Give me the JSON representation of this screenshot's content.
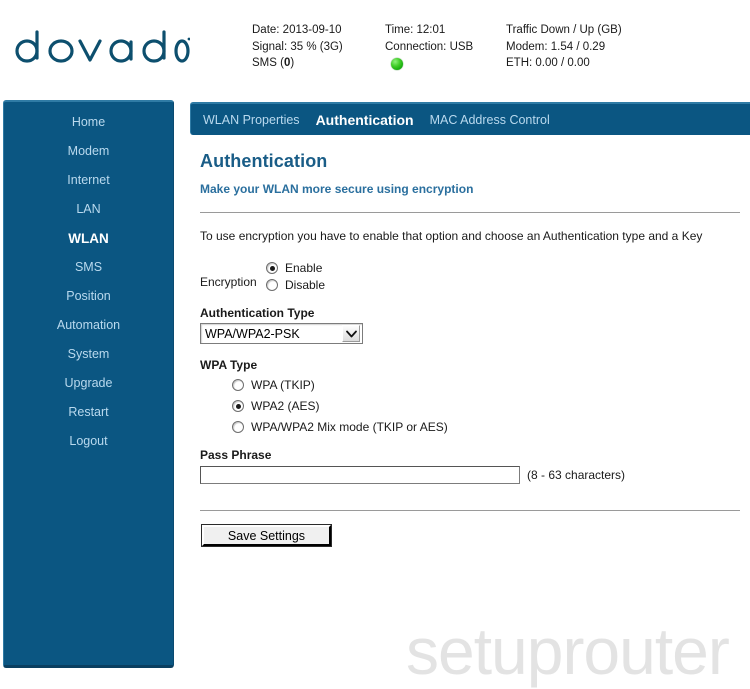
{
  "brand": {
    "logo_text": "dovado",
    "logo_color": "#0d4f6e"
  },
  "status_bar": {
    "col1": {
      "date": "Date: 2013-09-10",
      "signal": "Signal: 35 % (3G)",
      "sms": "SMS (0)",
      "sms_label": "SMS (",
      "sms_count": "0",
      "sms_label_end": ")"
    },
    "col2": {
      "time": "Time: 12:01",
      "connection": "Connection: USB",
      "led_color": "#2fbf1f",
      "led_state": "connected"
    },
    "col3": {
      "traffic_header": "Traffic Down / Up (GB)",
      "modem": "Modem: 1.54 / 0.29",
      "eth": "ETH: 0.00 / 0.00"
    }
  },
  "sidebar": {
    "background": "#0b5682",
    "items": [
      {
        "label": "Home",
        "active": false
      },
      {
        "label": "Modem",
        "active": false
      },
      {
        "label": "Internet",
        "active": false
      },
      {
        "label": "LAN",
        "active": false
      },
      {
        "label": "WLAN",
        "active": true
      },
      {
        "label": "SMS",
        "active": false
      },
      {
        "label": "Position",
        "active": false
      },
      {
        "label": "Automation",
        "active": false
      },
      {
        "label": "System",
        "active": false
      },
      {
        "label": "Upgrade",
        "active": false
      },
      {
        "label": "Restart",
        "active": false
      },
      {
        "label": "Logout",
        "active": false
      }
    ]
  },
  "tabs": [
    {
      "label": "WLAN Properties",
      "active": false
    },
    {
      "label": "Authentication",
      "active": true
    },
    {
      "label": "MAC Address Control",
      "active": false
    }
  ],
  "page": {
    "title": "Authentication",
    "subtitle": "Make your WLAN more secure using encryption",
    "intro": "To use encryption you have to enable that option and choose an Authentication type and a Key",
    "title_color": "#1a5d87"
  },
  "form": {
    "encryption": {
      "label": "Encryption",
      "options": [
        {
          "label": "Enable",
          "checked": true
        },
        {
          "label": "Disable",
          "checked": false
        }
      ]
    },
    "auth_type": {
      "label": "Authentication Type",
      "selected": "WPA/WPA2-PSK",
      "options": [
        "WPA/WPA2-PSK"
      ]
    },
    "wpa_type": {
      "label": "WPA Type",
      "options": [
        {
          "label": "WPA (TKIP)",
          "checked": false
        },
        {
          "label": "WPA2 (AES)",
          "checked": true
        },
        {
          "label": "WPA/WPA2 Mix mode (TKIP or AES)",
          "checked": false
        }
      ]
    },
    "pass_phrase": {
      "label": "Pass Phrase",
      "value": "",
      "placeholder": "",
      "hint": "(8 - 63 characters)"
    },
    "save_button": "Save Settings"
  },
  "watermark": "setuprouter"
}
